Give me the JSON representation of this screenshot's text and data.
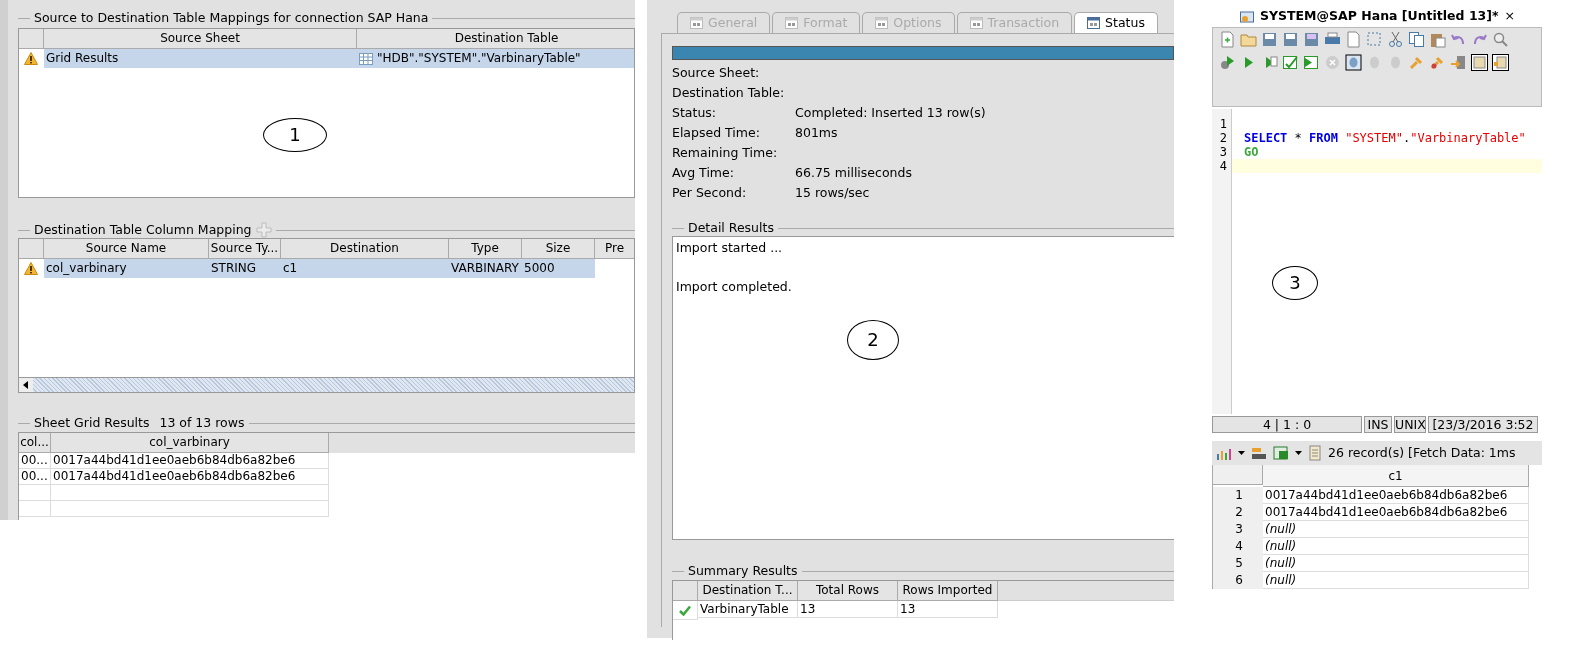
{
  "mapping_panel": {
    "callout": "1",
    "mappings": {
      "title": "Source to Destination Table Mappings for connection SAP Hana",
      "columns": [
        "Source Sheet",
        "Destination Table"
      ],
      "rows": [
        {
          "warning": true,
          "selected": true,
          "cells": [
            "Grid Results",
            "\"HDB\".\"SYSTEM\".\"VarbinaryTable\""
          ]
        }
      ]
    },
    "column_mapping": {
      "title": "Destination Table Column Mapping",
      "columns": [
        "Source Name",
        "Source Ty...",
        "Destination",
        "Type",
        "Size",
        "Pre"
      ],
      "rows": [
        {
          "warning": true,
          "selected": true,
          "cells": [
            "col_varbinary",
            "STRING",
            "c1",
            "VARBINARY",
            "5000"
          ]
        }
      ]
    },
    "sheet_grid": {
      "title": "Sheet Grid Results",
      "count": "13 of 13 rows",
      "columns": [
        "col...",
        "col_varbinary"
      ],
      "rows": [
        [
          "00...",
          "0017a44bd41d1ee0aeb6b84db6a82be6"
        ],
        [
          "00...",
          "0017a44bd41d1ee0aeb6b84db6a82be6"
        ]
      ]
    }
  },
  "status_panel": {
    "callout": "2",
    "tabs": [
      {
        "label": "General",
        "selected": false
      },
      {
        "label": "Format",
        "selected": false
      },
      {
        "label": "Options",
        "selected": false
      },
      {
        "label": "Transaction",
        "selected": false
      },
      {
        "label": "Status",
        "selected": true
      }
    ],
    "progress": {
      "level": 1
    },
    "fields": [
      {
        "label": "Source Sheet:"
      },
      {
        "label": "Destination Table:"
      },
      {
        "label": "Status:",
        "value": "Completed: Inserted 13 row(s)"
      },
      {
        "label": "Elapsed Time:",
        "value": "801ms"
      },
      {
        "label": "Remaining Time:"
      },
      {
        "label": "Avg Time:",
        "value": "66.75 milliseconds"
      },
      {
        "label": "Per Second:",
        "value": "15 rows/sec"
      }
    ],
    "detail": {
      "title": "Detail Results",
      "lines": [
        "Import started ...",
        "Import completed."
      ]
    },
    "summary": {
      "title": "Summary Results",
      "columns": [
        "Destination T...",
        "Total Rows",
        "Rows Imported"
      ],
      "rows": [
        {
          "ok": true,
          "cells": [
            "VarbinaryTable",
            "13",
            "13"
          ]
        }
      ]
    }
  },
  "editor_panel": {
    "callout": "3",
    "tab": {
      "title": "SYSTEM@SAP Hana [Untitled 13]*",
      "close": "×"
    },
    "code_lines": [
      {
        "number": "1",
        "current": false
      },
      {
        "number": "2",
        "current": false,
        "tokens": [
          {
            "kind": "keyword",
            "text": "SELECT"
          },
          {
            "kind": "plain",
            "text": " * "
          },
          {
            "kind": "keyword",
            "text": "FROM "
          },
          {
            "kind": "string",
            "text": "\"SYSTEM\""
          },
          {
            "kind": "plain",
            "text": "."
          },
          {
            "kind": "string",
            "text": "\"VarbinaryTable\""
          }
        ]
      },
      {
        "number": "3",
        "current": false,
        "tokens": [
          {
            "kind": "go",
            "text": "GO"
          }
        ]
      },
      {
        "number": "4",
        "current": true
      }
    ],
    "status_bar": [
      "4 | 1 : 0",
      "INS",
      "UNIX",
      "[23/3/2016 3:52"
    ],
    "results": {
      "summary": "26 record(s) [Fetch Data: 1ms",
      "columns": [
        "c1"
      ],
      "rows": [
        {
          "number": "1",
          "kind": "value",
          "text": "0017a44bd41d1ee0aeb6b84db6a82be6"
        },
        {
          "number": "2",
          "kind": "value",
          "text": "0017a44bd41d1ee0aeb6b84db6a82be6"
        },
        {
          "number": "3",
          "kind": "null",
          "text": "(null)"
        },
        {
          "number": "4",
          "kind": "null",
          "text": "(null)"
        },
        {
          "number": "5",
          "kind": "null",
          "text": "(null)"
        },
        {
          "number": "6",
          "kind": "null",
          "text": "(null)"
        }
      ]
    }
  }
}
